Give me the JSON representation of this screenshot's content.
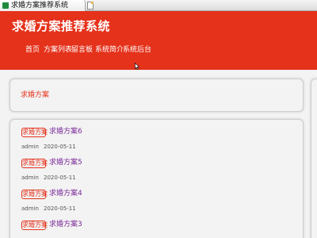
{
  "browser": {
    "tab_title": "求婚方案推荐系统",
    "favicon": "page-favicon",
    "new_tab_icon": "document-icon"
  },
  "header": {
    "site_title": "求婚方案推荐系统",
    "background_color": "#e5321b"
  },
  "nav": {
    "items": [
      "首页",
      "方案列表",
      "留言板",
      "系统简介",
      "系统后台"
    ]
  },
  "top_panel": {
    "section_title": "求婚方案"
  },
  "list": {
    "items": [
      {
        "tag": "求婚方案",
        "title": "求婚方案6",
        "author": "admin",
        "date": "2020-05-11"
      },
      {
        "tag": "求婚方案",
        "title": "求婚方案5",
        "author": "admin",
        "date": "2020-05-11"
      },
      {
        "tag": "求婚方案",
        "title": "求婚方案4",
        "author": "admin",
        "date": "2020-05-11"
      },
      {
        "tag": "求婚方案",
        "title": "求婚方案3"
      }
    ]
  }
}
